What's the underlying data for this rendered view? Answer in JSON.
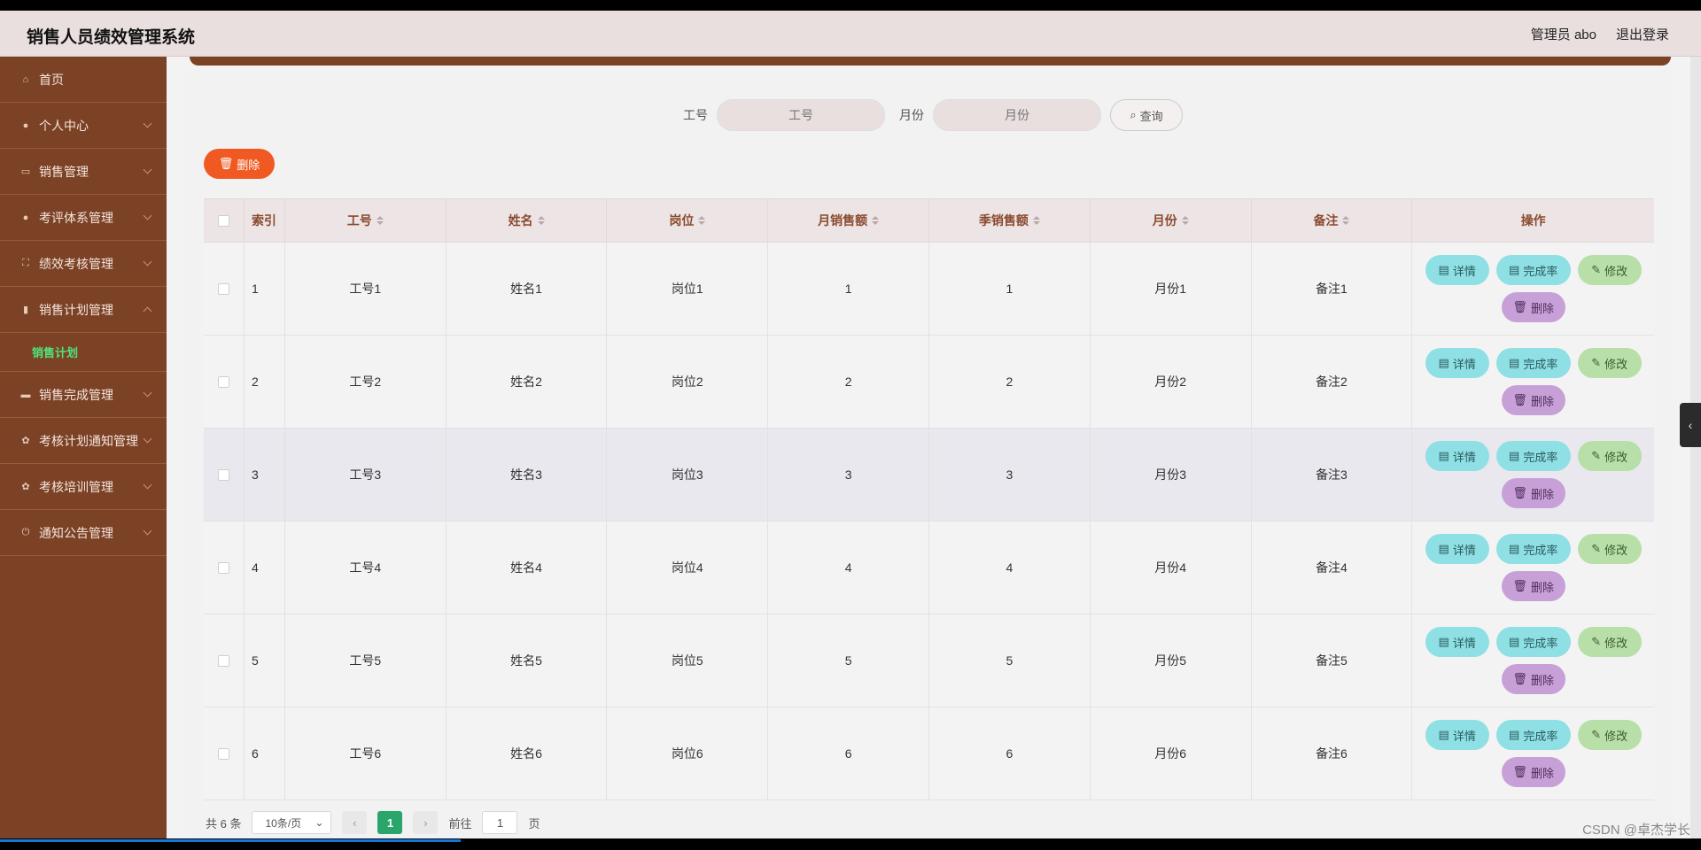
{
  "header": {
    "title": "销售人员绩效管理系统",
    "user": "管理员 abo",
    "logout": "退出登录"
  },
  "sidebar": {
    "items": [
      {
        "label": "首页",
        "icon": "home-icon",
        "glyph": "⌂"
      },
      {
        "label": "个人中心",
        "icon": "user-icon",
        "glyph": "●"
      },
      {
        "label": "销售管理",
        "icon": "chat-icon",
        "glyph": "▭"
      },
      {
        "label": "考评体系管理",
        "icon": "user-icon",
        "glyph": "●"
      },
      {
        "label": "绩效考核管理",
        "icon": "scan-icon",
        "glyph": "⛶"
      },
      {
        "label": "销售计划管理",
        "icon": "trash-icon",
        "glyph": "▮"
      },
      {
        "label": "销售完成管理",
        "icon": "briefcase-icon",
        "glyph": "▬"
      },
      {
        "label": "考核计划通知管理",
        "icon": "gear-icon",
        "glyph": "✿"
      },
      {
        "label": "考核培训管理",
        "icon": "gear-icon",
        "glyph": "✿"
      },
      {
        "label": "通知公告管理",
        "icon": "power-icon",
        "glyph": "⏻"
      }
    ],
    "active_sub": "销售计划"
  },
  "search": {
    "label_id": "工号",
    "placeholder_id": "工号",
    "label_month": "月份",
    "placeholder_month": "月份",
    "button": "查询",
    "button_icon": "search-icon"
  },
  "actions": {
    "delete": "删除"
  },
  "table": {
    "headers": [
      "索引",
      "工号",
      "姓名",
      "岗位",
      "月销售额",
      "季销售额",
      "月份",
      "备注",
      "操作"
    ],
    "rows": [
      {
        "idx": "1",
        "id": "工号1",
        "name": "姓名1",
        "post": "岗位1",
        "monthly": "1",
        "quarterly": "1",
        "month": "月份1",
        "note": "备注1"
      },
      {
        "idx": "2",
        "id": "工号2",
        "name": "姓名2",
        "post": "岗位2",
        "monthly": "2",
        "quarterly": "2",
        "month": "月份2",
        "note": "备注2"
      },
      {
        "idx": "3",
        "id": "工号3",
        "name": "姓名3",
        "post": "岗位3",
        "monthly": "3",
        "quarterly": "3",
        "month": "月份3",
        "note": "备注3"
      },
      {
        "idx": "4",
        "id": "工号4",
        "name": "姓名4",
        "post": "岗位4",
        "monthly": "4",
        "quarterly": "4",
        "month": "月份4",
        "note": "备注4"
      },
      {
        "idx": "5",
        "id": "工号5",
        "name": "姓名5",
        "post": "岗位5",
        "monthly": "5",
        "quarterly": "5",
        "month": "月份5",
        "note": "备注5"
      },
      {
        "idx": "6",
        "id": "工号6",
        "name": "姓名6",
        "post": "岗位6",
        "monthly": "6",
        "quarterly": "6",
        "month": "月份6",
        "note": "备注6"
      }
    ],
    "ops": {
      "detail": "详情",
      "rate": "完成率",
      "edit": "修改",
      "delete": "删除"
    }
  },
  "pager": {
    "total": "共 6 条",
    "page_size": "10条/页",
    "current": "1",
    "goto_label": "前往",
    "goto_value": "1",
    "page_suffix": "页"
  },
  "watermark": "CSDN @卓杰学长",
  "colors": {
    "sidebar": "#7c4226",
    "active_sub": "#52e27a",
    "delete_button": "#f05a22",
    "page_current": "#2aa66a"
  }
}
